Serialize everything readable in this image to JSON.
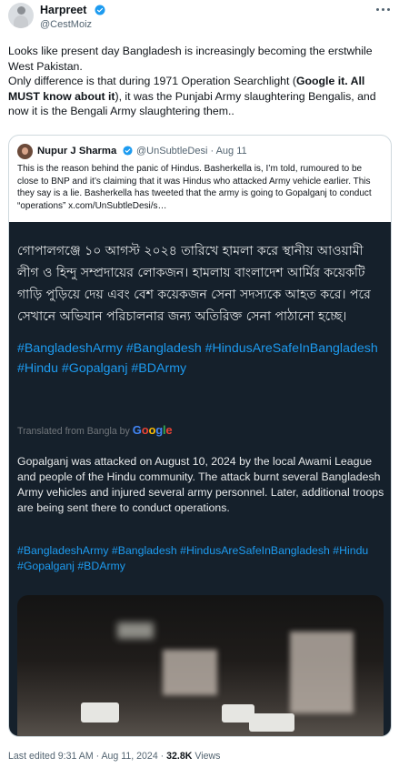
{
  "post": {
    "display_name": "Harpreet",
    "handle": "@CestMoiz",
    "text_part1": "Looks like present day Bangladesh is increasingly becoming the erstwhile West Pakistan.",
    "text_part2": "Only difference is that during 1971 Operation Searchlight (",
    "text_bold": "Google it. All MUST know about it",
    "text_part3": "), it was the Punjabi Army slaughtering Bengalis, and now it is the Bengali Army slaughtering them..",
    "footer_edited": "Last edited 9:31 AM · Aug 11, 2024 · ",
    "footer_views_count": "32.8K",
    "footer_views_label": " Views"
  },
  "quote": {
    "display_name": "Nupur J Sharma",
    "handle_date": "@UnSubtleDesi · Aug 11",
    "text": "This is the reason behind the panic of Hindus. Basherkella is, I’m told, rumoured to be close to BNP and it’s claiming that it was Hindus who attacked Army vehicle earlier. This they say is a lie. Basherkella has tweeted that the army is going to Gopalganj to conduct “operations”  x.com/UnSubtleDesi/s…"
  },
  "screenshot": {
    "bangla_text": "গোপালগঞ্জে ১০ আগস্ট ২০২৪ তারিখে হামলা করে স্থানীয় আওয়ামী লীগ ও হিন্দু সম্প্রদায়ের লোকজন। হামলায় বাংলাদেশ আর্মির কয়েকটি গাড়ি পুড়িয়ে দেয় এবং বেশ কয়েকজন সেনা সদস্যকে আহত করে। পরে সেখানে অভিযান পরিচালনার জন্য অতিরিক্ত সেনা পাঠানো হচ্ছে।",
    "hashtags_top": "#BangladeshArmy #Bangladesh #HindusAreSafeInBangladesh #Hindu #Gopalganj #BDArmy",
    "translated_label": "Translated from Bangla by ",
    "google_logo": "Google",
    "english_text": "Gopalganj was attacked on August 10, 2024 by the local Awami League and people of the Hindu community. The attack burnt several Bangladesh Army vehicles and injured several army personnel. Later, additional troops are being sent there to conduct operations.",
    "hashtags_bottom": "#BangladeshArmy #Bangladesh #HindusAreSafeInBangladesh #Hindu #Gopalganj #BDArmy"
  },
  "icons": {
    "more": "more-horizontal-icon",
    "verified": "verified-badge-icon"
  },
  "colors": {
    "link_blue": "#1d9bf0",
    "verified_blue": "#1d9bf0",
    "dark_bg": "#15202b"
  }
}
